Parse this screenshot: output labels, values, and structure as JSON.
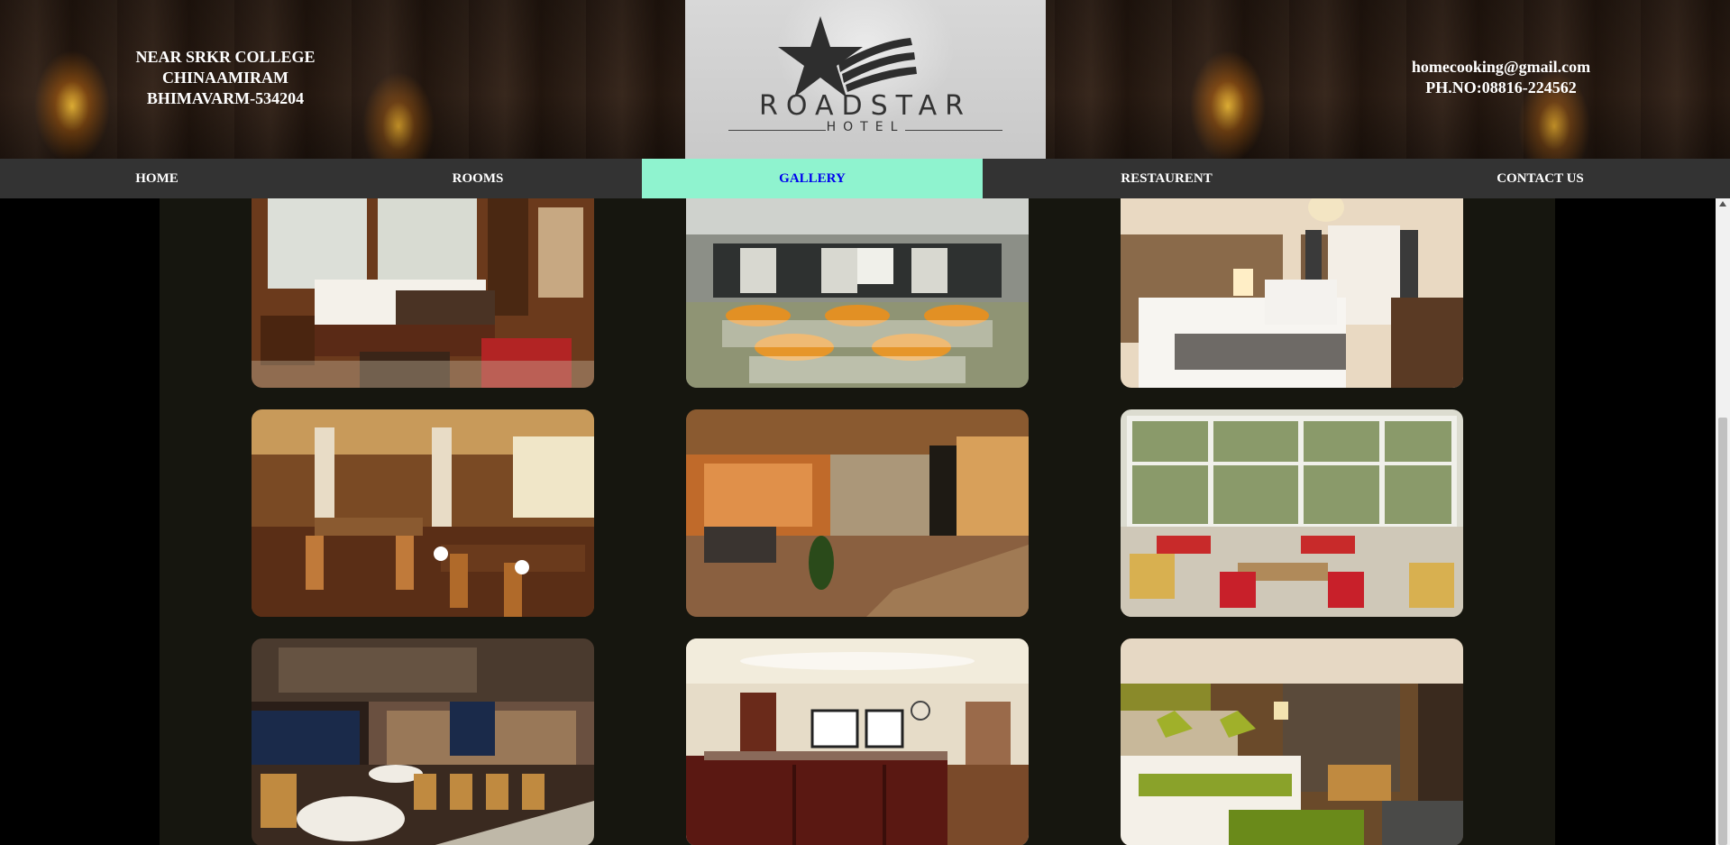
{
  "header": {
    "address": [
      "NEAR SRKR COLLEGE",
      "CHINAAMIRAM",
      "BHIMAVARM-534204"
    ],
    "contact": [
      "homecooking@gmail.com",
      "PH.NO:08816-224562"
    ],
    "logo_text": "ROADSTAR",
    "logo_sub": "HOTEL"
  },
  "nav": {
    "items": [
      {
        "label": "HOME",
        "active": false
      },
      {
        "label": "ROOMS",
        "active": false
      },
      {
        "label": "GALLERY",
        "active": true
      },
      {
        "label": "RESTAURENT",
        "active": false
      },
      {
        "label": "CONTACT US",
        "active": false
      }
    ]
  },
  "gallery": {
    "images": [
      {
        "name": "gallery-image-hotel-room-red-rug",
        "scene": "room"
      },
      {
        "name": "gallery-image-banquet-hall",
        "scene": "banquet"
      },
      {
        "name": "gallery-image-twin-bed-room",
        "scene": "twin"
      },
      {
        "name": "gallery-image-restaurant-wooden",
        "scene": "diner"
      },
      {
        "name": "gallery-image-glass-lobby",
        "scene": "lobby"
      },
      {
        "name": "gallery-image-garden-restaurant",
        "scene": "garden"
      },
      {
        "name": "gallery-image-bar-dining",
        "scene": "bar"
      },
      {
        "name": "gallery-image-reception-desk",
        "scene": "reception"
      },
      {
        "name": "gallery-image-green-twin-room",
        "scene": "greenroom"
      }
    ]
  },
  "colors": {
    "nav_bg": "#333333",
    "nav_active_bg": "#8ff3cf",
    "nav_active_text": "#0000ee",
    "content_bg": "#16160f"
  }
}
